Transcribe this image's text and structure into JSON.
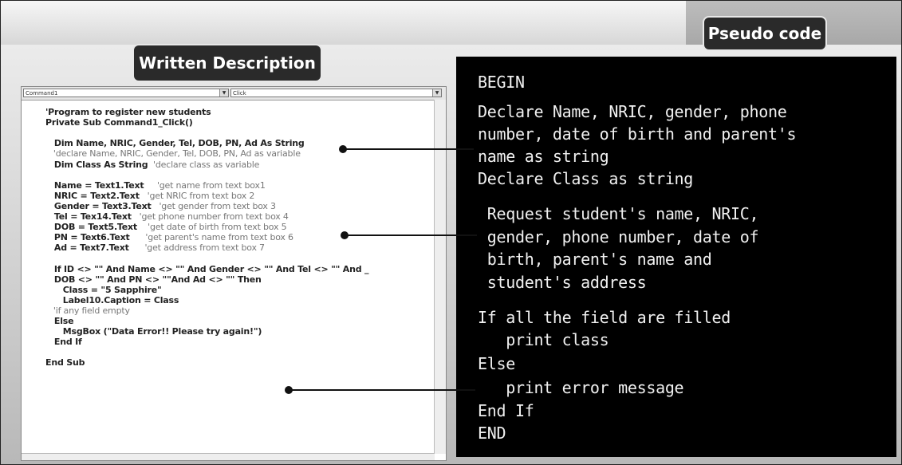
{
  "labels": {
    "pseudo_code": "Pseudo code",
    "written_description": "Written Description"
  },
  "vb_editor": {
    "object_combo": "Command1",
    "procedure_combo": "Click",
    "lines": [
      {
        "code": "'Program to register new students",
        "comment": ""
      },
      {
        "code": "Private Sub Command1_Click()",
        "comment": ""
      },
      {
        "code": "",
        "comment": ""
      },
      {
        "code": "   Dim Name, NRIC, Gender, Tel, DOB, PN, Ad As String",
        "comment": ""
      },
      {
        "code": "",
        "comment": "   'declare Name, NRIC, Gender, Tel, DOB, PN, Ad as variable"
      },
      {
        "code": "   Dim Class As String",
        "comment": "  'declare class as variable"
      },
      {
        "code": "",
        "comment": ""
      },
      {
        "code": "   Name = Text1.Text",
        "comment": "     'get name from text box1"
      },
      {
        "code": "   NRIC = Text2.Text",
        "comment": "   'get NRIC from text box 2"
      },
      {
        "code": "   Gender = Text3.Text",
        "comment": "   'get gender from text box 3"
      },
      {
        "code": "   Tel = Tex14.Text",
        "comment": "   'get phone number from text box 4"
      },
      {
        "code": "   DOB = Text5.Text",
        "comment": "    'get date of birth from text box 5"
      },
      {
        "code": "   PN = Text6.Text",
        "comment": "      'get parent's name from text box 6"
      },
      {
        "code": "   Ad = Text7.Text",
        "comment": "      'get address from text box 7"
      },
      {
        "code": "",
        "comment": ""
      },
      {
        "code": "   If ID <> \"\" And Name <> \"\" And Gender <> \"\" And Tel <> \"\" And _",
        "comment": ""
      },
      {
        "code": "   DOB <> \"\" And PN <> \"\"And Ad <> \"\" Then",
        "comment": ""
      },
      {
        "code": "      Class = \"5 Sapphire\"",
        "comment": ""
      },
      {
        "code": "      Label10.Caption = Class",
        "comment": ""
      },
      {
        "code": "",
        "comment": "   'if any field empty"
      },
      {
        "code": "   Else",
        "comment": ""
      },
      {
        "code": "      MsgBox (\"Data Error!! Please try again!\")",
        "comment": ""
      },
      {
        "code": "   End If",
        "comment": ""
      },
      {
        "code": "",
        "comment": ""
      },
      {
        "code": "End Sub",
        "comment": ""
      }
    ]
  },
  "pseudo": {
    "lines": [
      "BEGIN",
      "Declare Name, NRIC, gender, phone",
      "number, date of birth and parent's",
      "name as string",
      "Declare Class as string",
      "",
      " Request student's name, NRIC,",
      " gender, phone number, date of",
      " birth, parent's name and",
      " student's address",
      "",
      "If all the field are filled",
      "   print class",
      "Else",
      "   print error message",
      "End If",
      "END"
    ]
  }
}
